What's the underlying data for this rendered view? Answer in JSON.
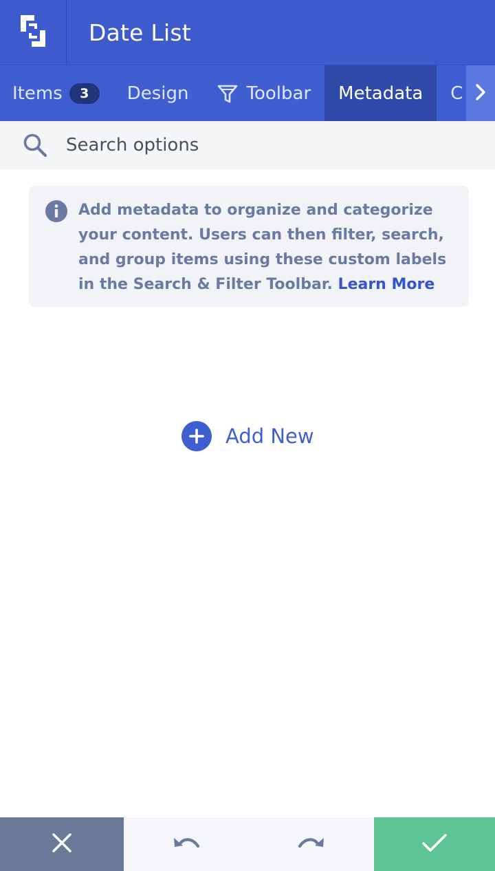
{
  "app": {
    "title": "Date List",
    "logo_icon": "brand-bracket-logo-icon",
    "accent_color": "#3d5bcc"
  },
  "tabs": {
    "items": [
      {
        "label": "Items",
        "badge": "3",
        "active": false
      },
      {
        "label": "Design",
        "active": false
      },
      {
        "label": "Toolbar",
        "icon": "filter-funnel-icon",
        "active": false
      },
      {
        "label": "Metadata",
        "active": true
      },
      {
        "label": "C",
        "clipped": true,
        "active": false
      }
    ],
    "scroll_icon": "chevron-right-icon"
  },
  "search": {
    "placeholder": "Search options",
    "value": "",
    "icon": "search-icon"
  },
  "info": {
    "icon": "info-icon",
    "text": "Add metadata to organize and categorize your content. Users can then filter, search, and group items using these custom labels in the Search & Filter Toolbar.",
    "link_label": "Learn More"
  },
  "add_new": {
    "label": "Add New",
    "icon": "plus-circle-icon"
  },
  "footer": {
    "cancel_icon": "close-icon",
    "undo_icon": "undo-icon",
    "redo_icon": "redo-icon",
    "save_icon": "checkmark-icon",
    "cancel_color": "#6c7a9a",
    "save_color": "#5cc497"
  }
}
